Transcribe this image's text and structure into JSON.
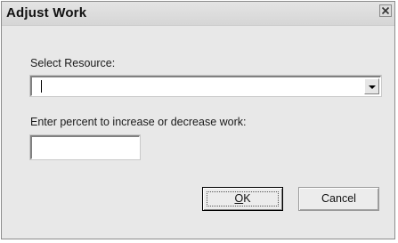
{
  "window": {
    "title": "Adjust Work"
  },
  "form": {
    "resource_label": "Select Resource:",
    "resource_value": "",
    "percent_label": "Enter percent to increase or decrease work:",
    "percent_value": ""
  },
  "buttons": {
    "ok_hotkey": "O",
    "ok_rest": "K",
    "cancel_label": "Cancel"
  },
  "icons": {
    "close": "close-icon",
    "dropdown": "chevron-down-icon"
  },
  "colors": {
    "dialog_bg": "#e8e8e8",
    "titlebar_bg": "#dcdcdc",
    "field_bg": "#ffffff"
  }
}
